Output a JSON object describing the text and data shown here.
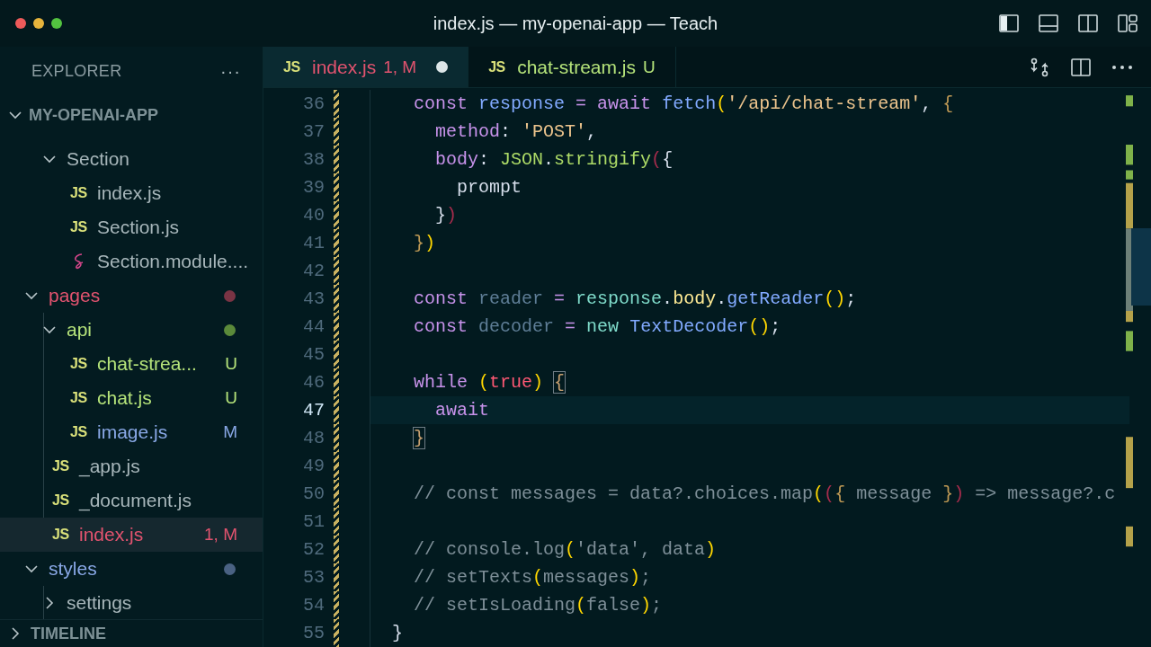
{
  "window": {
    "title": "index.js — my-openai-app — Teach"
  },
  "explorer": {
    "title": "EXPLORER",
    "more": "···",
    "project": "MY-OPENAI-APP",
    "project_expanded": true,
    "tree": [
      {
        "children": [
          {
            "kind": "folder",
            "name": "Section",
            "expanded": true,
            "selected": false,
            "children": [
              {
                "kind": "js",
                "icon_label": "JS",
                "name": "index.js",
                "selected": false
              },
              {
                "kind": "js",
                "icon_label": "JS",
                "name": "Section.js",
                "selected": false
              },
              {
                "kind": "scss",
                "name": "Section.module....",
                "selected": false
              }
            ]
          }
        ]
      },
      {
        "kind": "folder",
        "name": "pages",
        "expanded": true,
        "selected": false,
        "error": true,
        "color": "#7a3444",
        "children": [
          {
            "kind": "folder",
            "name": "api",
            "expanded": true,
            "selected": false,
            "untracked": true,
            "color": "#5b8a3a",
            "children": [
              {
                "kind": "js",
                "icon_label": "JS",
                "name": "chat-strea...",
                "badge": "U",
                "untracked": true,
                "selected": false
              },
              {
                "kind": "js",
                "icon_label": "JS",
                "name": "chat.js",
                "badge": "U",
                "untracked": true,
                "selected": false
              },
              {
                "kind": "js",
                "icon_label": "JS",
                "name": "image.js",
                "badge": "M",
                "modified": true,
                "selected": false
              }
            ]
          },
          {
            "kind": "js",
            "icon_label": "JS",
            "name": "_app.js",
            "selected": false
          },
          {
            "kind": "js",
            "icon_label": "JS",
            "name": "_document.js",
            "selected": false
          },
          {
            "kind": "js",
            "icon_label": "JS",
            "name": "index.js",
            "badge": "1, M",
            "error": true,
            "selected": true
          }
        ]
      },
      {
        "kind": "folder",
        "name": "styles",
        "expanded": true,
        "selected": false,
        "modified": true,
        "color": "#4a6283",
        "children": [
          {
            "kind": "folder",
            "name": "settings",
            "expanded": false,
            "selected": false
          }
        ]
      }
    ],
    "timeline": {
      "title": "TIMELINE",
      "expanded": false
    }
  },
  "tabs": [
    {
      "icon_label": "JS",
      "label": "index.js",
      "badge": "1, M",
      "error": true,
      "dirty": true,
      "selected": true
    },
    {
      "icon_label": "JS",
      "label": "chat-stream.js",
      "badge": "U",
      "untracked": true,
      "dirty": false,
      "selected": false
    }
  ],
  "editor": {
    "lines": [
      {
        "number": "36",
        "current": false,
        "tokens": [
          {
            "kind": "keyword",
            "text": "    const"
          },
          {
            "kind": "variable",
            "text": " response"
          },
          {
            "kind": "operator",
            "text": " = "
          },
          {
            "kind": "keyword",
            "text": "await"
          },
          {
            "kind": "function",
            "text": " fetch"
          },
          {
            "kind": "bracket",
            "text": "("
          },
          {
            "kind": "string",
            "text": "'/api/chat-stream'"
          },
          {
            "kind": "punct",
            "text": ", "
          },
          {
            "kind": "bracket2",
            "text": "{"
          }
        ]
      },
      {
        "number": "37",
        "current": false,
        "tokens": [
          {
            "kind": "property",
            "text": "      method"
          },
          {
            "kind": "punct",
            "text": ": "
          },
          {
            "kind": "string",
            "text": "'POST'"
          },
          {
            "kind": "punct",
            "text": ","
          }
        ]
      },
      {
        "number": "38",
        "current": false,
        "tokens": [
          {
            "kind": "property",
            "text": "      body"
          },
          {
            "kind": "punct",
            "text": ": "
          },
          {
            "kind": "object",
            "text": "JSON"
          },
          {
            "kind": "punct",
            "text": "."
          },
          {
            "kind": "object",
            "text": "stringify"
          },
          {
            "kind": "bracket-error",
            "text": "("
          },
          {
            "kind": "plain",
            "text": "{"
          }
        ]
      },
      {
        "number": "39",
        "current": false,
        "tokens": [
          {
            "kind": "plain",
            "text": "        prompt"
          }
        ]
      },
      {
        "number": "40",
        "current": false,
        "tokens": [
          {
            "kind": "plain",
            "text": "      }"
          },
          {
            "kind": "bracket-error",
            "text": ")"
          }
        ]
      },
      {
        "number": "41",
        "current": false,
        "tokens": [
          {
            "kind": "bracket2",
            "text": "    }"
          },
          {
            "kind": "bracket",
            "text": ")"
          }
        ]
      },
      {
        "number": "42",
        "current": false
      },
      {
        "number": "43",
        "current": false,
        "tokens": [
          {
            "kind": "keyword",
            "text": "    const"
          },
          {
            "kind": "unused",
            "text": " reader"
          },
          {
            "kind": "operator",
            "text": " = "
          },
          {
            "kind": "member",
            "text": "response"
          },
          {
            "kind": "punct",
            "text": "."
          },
          {
            "kind": "field",
            "text": "body"
          },
          {
            "kind": "punct",
            "text": "."
          },
          {
            "kind": "function",
            "text": "getReader"
          },
          {
            "kind": "bracket",
            "text": "()"
          },
          {
            "kind": "punct",
            "text": ";"
          }
        ]
      },
      {
        "number": "44",
        "current": false,
        "tokens": [
          {
            "kind": "keyword",
            "text": "    const"
          },
          {
            "kind": "unused",
            "text": " decoder"
          },
          {
            "kind": "operator",
            "text": " = "
          },
          {
            "kind": "new",
            "text": "new"
          },
          {
            "kind": "class",
            "text": " TextDecoder"
          },
          {
            "kind": "bracket",
            "text": "()"
          },
          {
            "kind": "punct",
            "text": ";"
          }
        ]
      },
      {
        "number": "45",
        "current": false
      },
      {
        "number": "46",
        "current": false,
        "tokens": [
          {
            "kind": "keyword",
            "text": "    while"
          },
          {
            "kind": "bracket",
            "text": " ("
          },
          {
            "kind": "boolean",
            "text": "true"
          },
          {
            "kind": "bracket",
            "text": ")"
          },
          {
            "kind": "bracket-match",
            "text": " {"
          }
        ]
      },
      {
        "number": "47",
        "current": true,
        "tokens": [
          {
            "kind": "keyword",
            "text": "      await"
          }
        ]
      },
      {
        "number": "48",
        "current": false,
        "tokens": [
          {
            "kind": "bracket-match",
            "text": "    }"
          }
        ]
      },
      {
        "number": "49",
        "current": false
      },
      {
        "number": "50",
        "current": false,
        "tokens": [
          {
            "kind": "comment",
            "text": "    // const messages = data?.choices.map"
          },
          {
            "kind": "bracket",
            "text": "("
          },
          {
            "kind": "bracket-error",
            "text": "("
          },
          {
            "kind": "bracket2",
            "text": "{"
          },
          {
            "kind": "comment",
            "text": " message "
          },
          {
            "kind": "bracket2",
            "text": "}"
          },
          {
            "kind": "bracket-error",
            "text": ")"
          },
          {
            "kind": "comment",
            "text": " => message?.c"
          }
        ]
      },
      {
        "number": "51",
        "current": false
      },
      {
        "number": "52",
        "current": false,
        "tokens": [
          {
            "kind": "comment",
            "text": "    // console.log"
          },
          {
            "kind": "bracket",
            "text": "("
          },
          {
            "kind": "comment",
            "text": "'data', data"
          },
          {
            "kind": "bracket",
            "text": ")"
          }
        ]
      },
      {
        "number": "53",
        "current": false,
        "tokens": [
          {
            "kind": "comment",
            "text": "    // setTexts"
          },
          {
            "kind": "bracket",
            "text": "("
          },
          {
            "kind": "comment",
            "text": "messages"
          },
          {
            "kind": "bracket",
            "text": ")"
          },
          {
            "kind": "comment",
            "text": ";"
          }
        ]
      },
      {
        "number": "54",
        "current": false,
        "tokens": [
          {
            "kind": "comment",
            "text": "    // setIsLoading"
          },
          {
            "kind": "bracket",
            "text": "("
          },
          {
            "kind": "comment",
            "text": "false"
          },
          {
            "kind": "bracket",
            "text": ")"
          },
          {
            "kind": "comment",
            "text": ";"
          }
        ]
      },
      {
        "number": "55",
        "current": false,
        "tokens": [
          {
            "kind": "plain",
            "text": "  }"
          }
        ]
      }
    ]
  }
}
